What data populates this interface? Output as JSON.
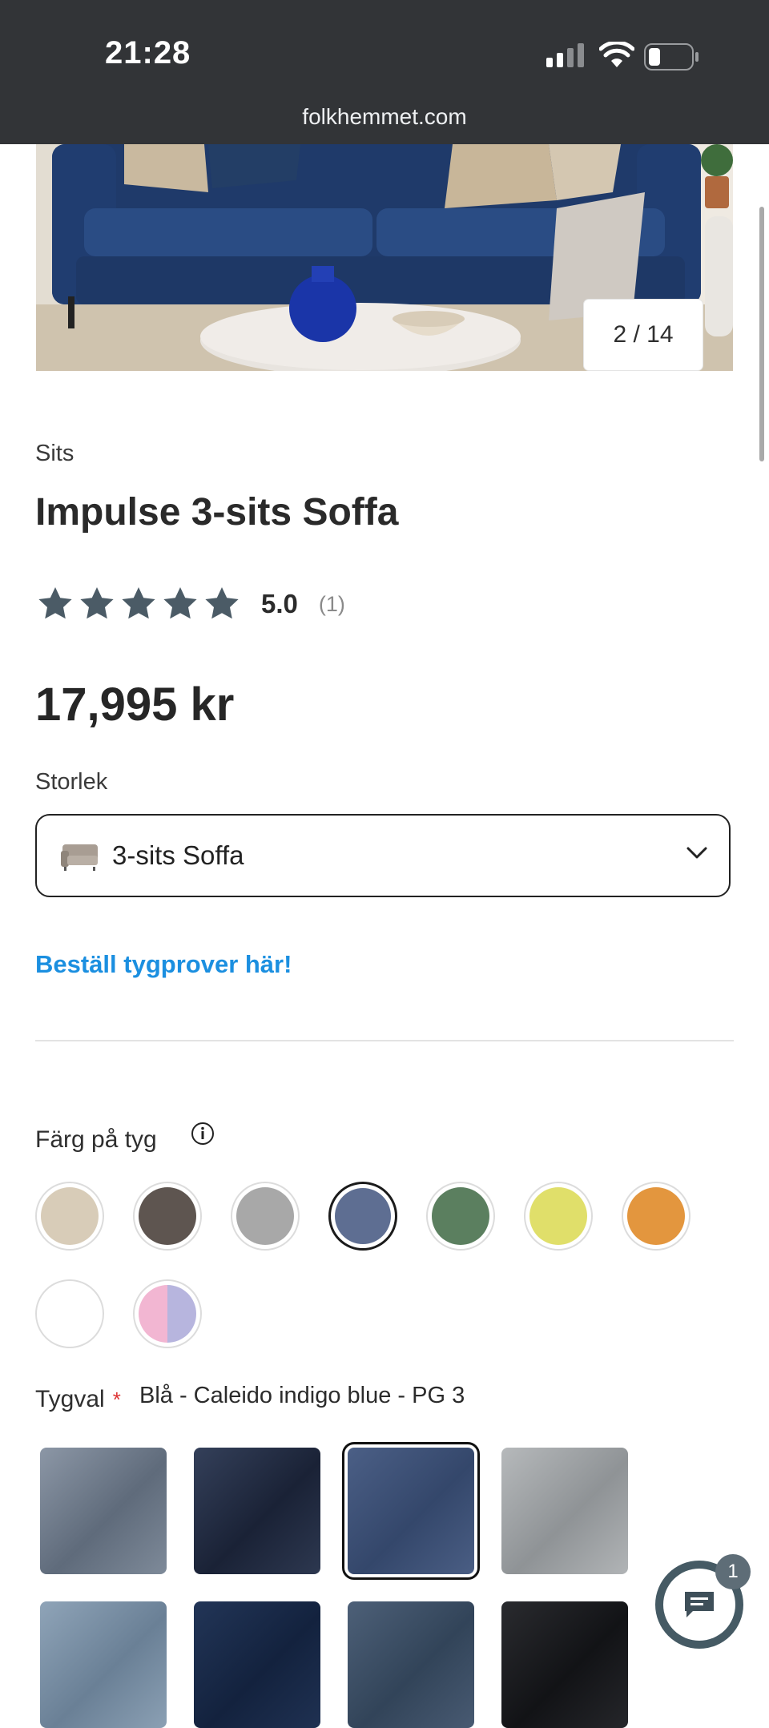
{
  "status_bar": {
    "time": "21:28",
    "url": "folkhemmet.com"
  },
  "gallery": {
    "counter": "2 / 14"
  },
  "product": {
    "category": "Sits",
    "title": "Impulse 3-sits Soffa",
    "rating_value": "5.0",
    "rating_count": "(1)",
    "stars": 5,
    "price": "17,995 kr"
  },
  "size": {
    "label": "Storlek",
    "selected": "3-sits Soffa"
  },
  "samples_link": "Beställ tygprover här!",
  "fabric_color": {
    "label": "Färg på tyg",
    "swatches": [
      {
        "name": "beige",
        "color": "#d8ccb8"
      },
      {
        "name": "brown",
        "color": "#5e5550"
      },
      {
        "name": "grey",
        "color": "#a8a8a8"
      },
      {
        "name": "blue",
        "color": "#5e6e92",
        "selected": true
      },
      {
        "name": "green",
        "color": "#5b7f5f"
      },
      {
        "name": "yellow",
        "color": "#e0df6a"
      },
      {
        "name": "orange",
        "color": "#e3963e"
      },
      {
        "name": "white",
        "color": "#ffffff"
      },
      {
        "name": "pink-lilac",
        "colors": [
          "#f2b6d2",
          "#b7b5de"
        ]
      }
    ]
  },
  "fabric_choice": {
    "label": "Tygval",
    "required_mark": "*",
    "value": "Blå - Caleido indigo blue - PG 3",
    "tiles": [
      {
        "name": "grey-blue-velvet",
        "color": "#707d8f",
        "selected": false
      },
      {
        "name": "dark-navy-velvet",
        "color": "#27324a",
        "selected": false
      },
      {
        "name": "indigo-blue",
        "color": "#3e5278",
        "selected": true
      },
      {
        "name": "light-grey",
        "color": "#a9acae",
        "selected": false
      },
      {
        "name": "light-blue-velvet",
        "color": "#7e94a8",
        "selected": false
      },
      {
        "name": "deep-navy",
        "color": "#1b2c4b",
        "selected": false
      },
      {
        "name": "slate-blue",
        "color": "#40536a",
        "selected": false
      },
      {
        "name": "black",
        "color": "#1c1d20",
        "selected": false
      }
    ]
  },
  "chat": {
    "badge": "1"
  }
}
